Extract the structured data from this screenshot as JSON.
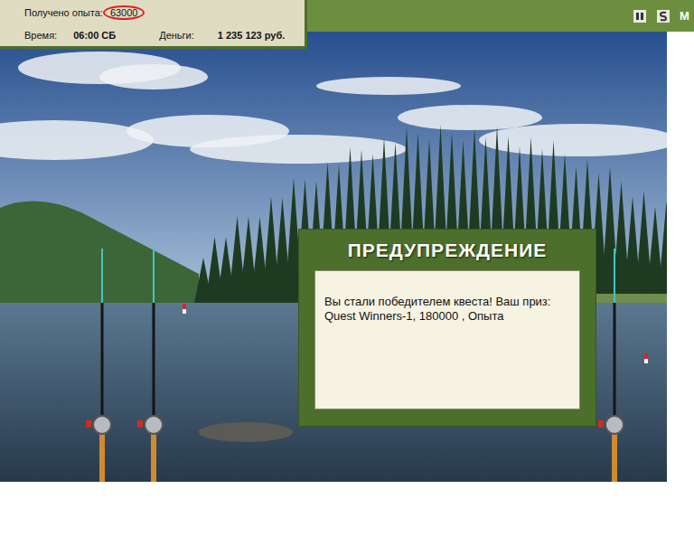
{
  "stats": {
    "experience": {
      "label": "Получено опыта:",
      "value": "63000",
      "highlighted": true
    },
    "time": {
      "label": "Время:",
      "value": "06:00 СБ"
    },
    "money": {
      "label": "Деньги:",
      "value": "1 235 123 руб."
    }
  },
  "toolbar": {
    "buttons": [
      {
        "kind": "pause"
      },
      {
        "kind": "sound"
      }
    ],
    "menu_label": "M"
  },
  "dialog": {
    "title": "ПРЕДУПРЕЖДЕНИЕ",
    "message": "Вы стали победителем квеста! Ваш приз: Quest Winners-1, 180000 , Опыта"
  }
}
